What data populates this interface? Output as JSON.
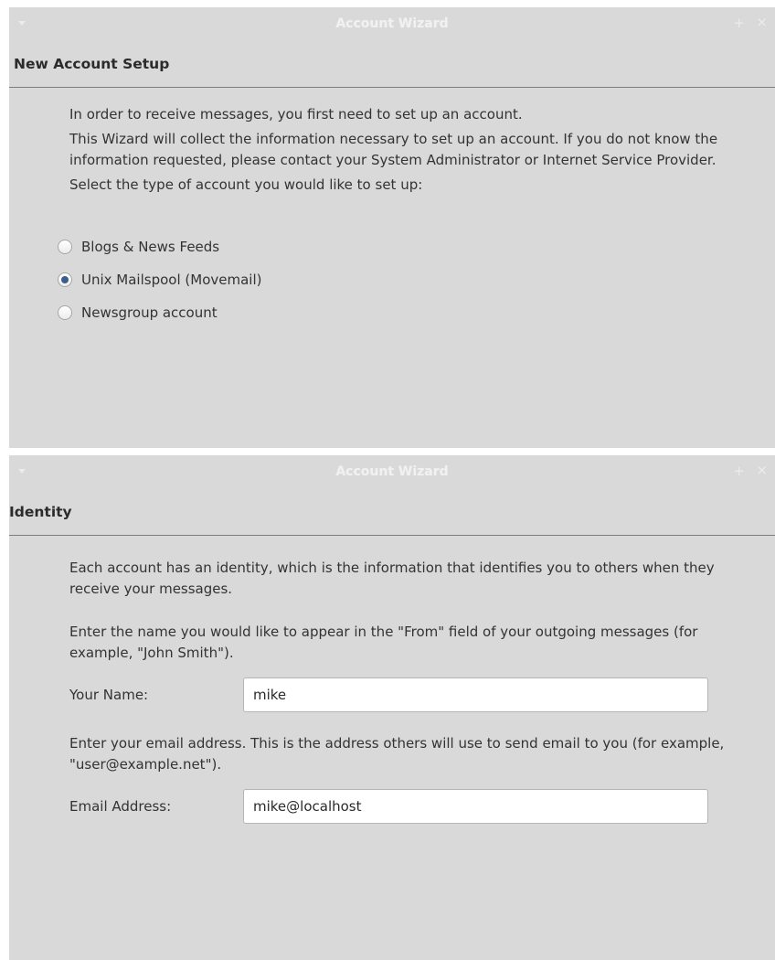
{
  "windows": [
    {
      "title": "Account Wizard",
      "page_title": "New Account Setup",
      "paragraphs": [
        "In order to receive messages, you first need to set up an account.",
        "This Wizard will collect the information necessary to set up an account. If you do not know the information requested, please contact your System Administrator or Internet Service Provider.",
        "Select the type of account you would like to set up:"
      ],
      "radio_options": [
        {
          "label": "Blogs & News Feeds",
          "checked": false
        },
        {
          "label": "Unix Mailspool (Movemail)",
          "checked": true
        },
        {
          "label": "Newsgroup account",
          "checked": false
        }
      ]
    },
    {
      "title": "Account Wizard",
      "page_title": "Identity",
      "intro": "Each account has an identity, which is the information that identifies you to others when they receive your messages.",
      "name_help": "Enter the name you would like to appear in the \"From\" field of your outgoing messages (for example, \"John Smith\").",
      "name_label": "Your Name:",
      "name_value": "mike",
      "email_help": "Enter your email address. This is the address others will use to send email to you (for example, \"user@example.net\").",
      "email_label": "Email Address:",
      "email_value": "mike@localhost"
    }
  ],
  "colors": {
    "window_bg": "#d9d9d9",
    "titlebar_text": "#f1f1f1",
    "radio_dot": "#3b5f8c"
  }
}
